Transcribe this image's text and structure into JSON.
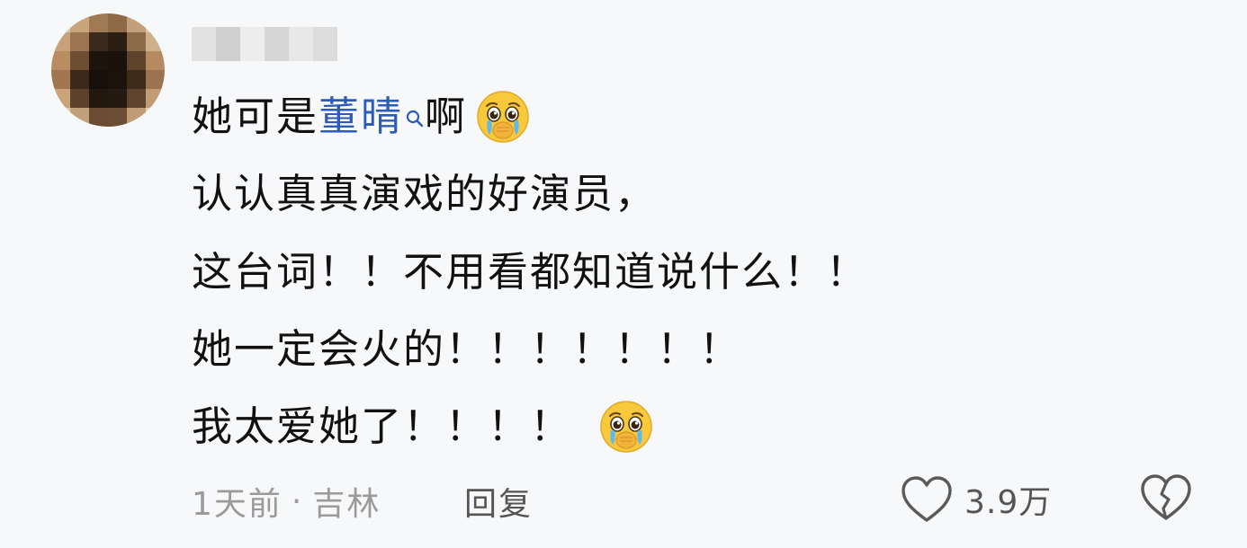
{
  "comment": {
    "lines": [
      {
        "before": "她可是",
        "mention": "董晴",
        "after": "啊"
      },
      {
        "text": "认认真真演戏的好演员，"
      },
      {
        "text": "这台词！！不用看都知道说什么！！"
      },
      {
        "text": "她一定会火的！！！！！！！"
      },
      {
        "text": "我太爱她了！！！！"
      }
    ],
    "emoji": "pleading-crying-face",
    "meta": {
      "time": "1天前",
      "separator": "·",
      "location": "吉林"
    },
    "reply_label": "回复",
    "like_count": "3.9万",
    "icons": {
      "like": "heart-outline-icon",
      "dislike": "broken-heart-icon",
      "mention_search": "search-icon"
    },
    "colors": {
      "background": "#f7f8fa",
      "text": "#111111",
      "mention": "#2c5bb8",
      "meta": "#9a9a9a"
    }
  }
}
